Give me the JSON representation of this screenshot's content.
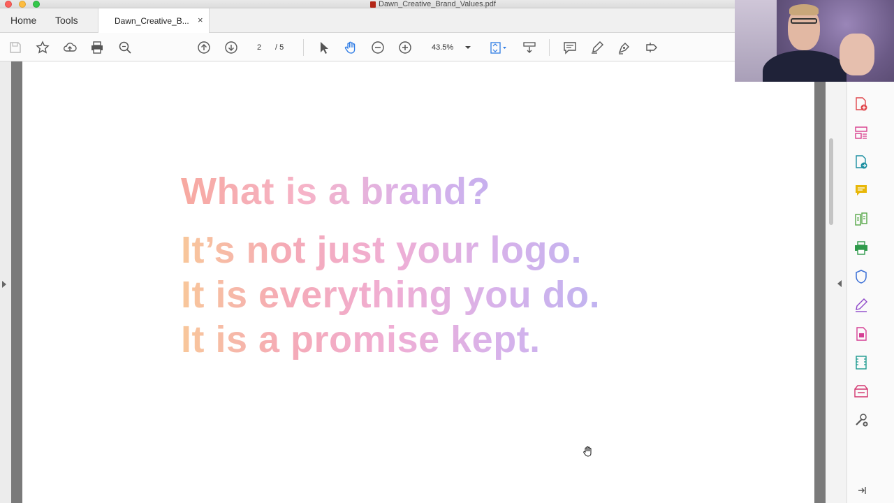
{
  "window": {
    "title": "Dawn_Creative_Brand_Values.pdf"
  },
  "tabs": {
    "home": "Home",
    "tools": "Tools",
    "document": "Dawn_Creative_B...",
    "close": "×"
  },
  "toolbar": {
    "current_page": "2",
    "total_pages": "/ 5",
    "zoom": "43.5%",
    "icons": [
      "save-icon",
      "bookmark-star-icon",
      "upload-icon",
      "print-icon",
      "search-zoom-icon",
      "page-up-icon",
      "page-down-icon",
      "select-arrow-icon",
      "hand-tool-icon",
      "zoom-out-icon",
      "zoom-in-icon",
      "fit-page-icon",
      "scroll-mode-icon",
      "comment-icon",
      "highlight-pen-icon",
      "sign-icon",
      "more-tools-icon"
    ]
  },
  "slide": {
    "heading": "What is a brand?",
    "lines": [
      "It’s not just your logo.",
      "It is everything you do.",
      "It is a promise kept."
    ]
  },
  "tools_pane": {
    "icons": [
      {
        "name": "create-pdf-icon",
        "color": "#e0474c"
      },
      {
        "name": "organize-pages-icon",
        "color": "#d83c8c"
      },
      {
        "name": "export-pdf-icon",
        "color": "#1d8fa1"
      },
      {
        "name": "comment-tool-icon",
        "color": "#e8b708"
      },
      {
        "name": "compare-files-icon",
        "color": "#54a646"
      },
      {
        "name": "print-production-icon",
        "color": "#2f9a4b"
      },
      {
        "name": "protect-icon",
        "color": "#3b6fd6"
      },
      {
        "name": "fill-sign-icon",
        "color": "#8e47c9"
      },
      {
        "name": "edit-pdf-icon",
        "color": "#d53f94"
      },
      {
        "name": "rich-media-icon",
        "color": "#1d9a8f"
      },
      {
        "name": "send-for-review-icon",
        "color": "#d3356f"
      },
      {
        "name": "customize-tools-icon",
        "color": "#555555"
      }
    ]
  }
}
